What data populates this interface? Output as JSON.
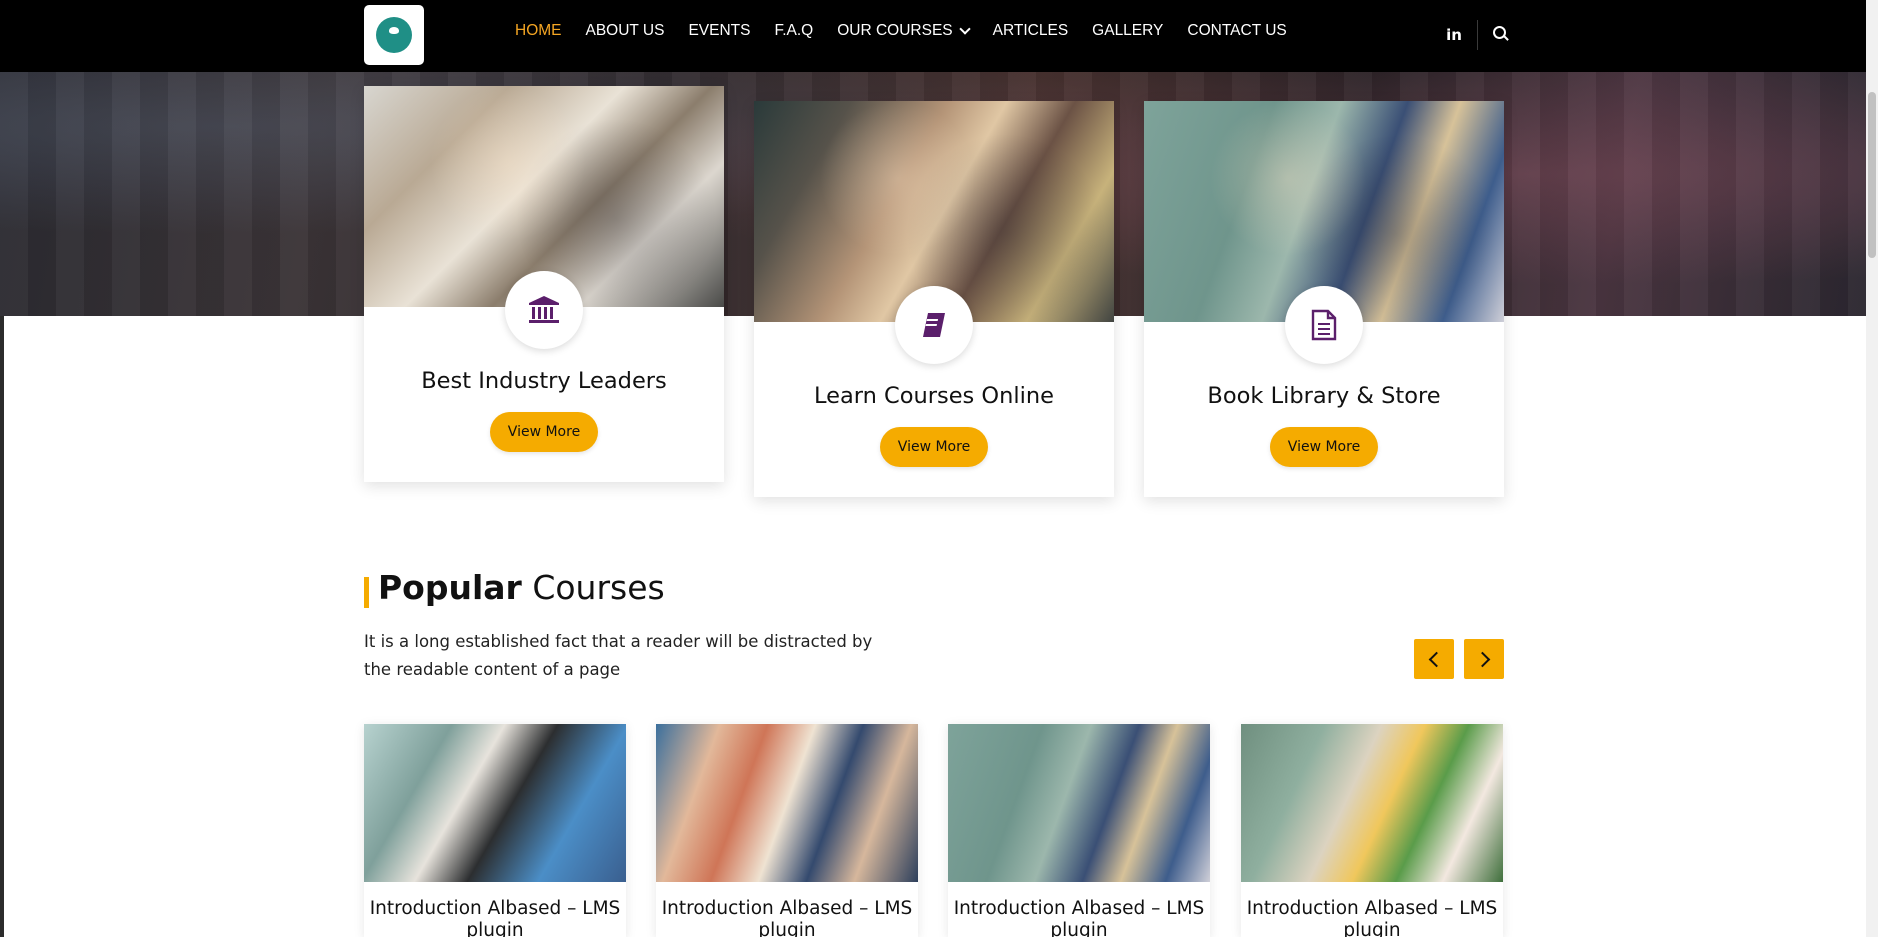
{
  "nav": {
    "items": [
      {
        "label": "HOME",
        "active": true
      },
      {
        "label": "ABOUT US"
      },
      {
        "label": "EVENTS"
      },
      {
        "label": "F.A.Q"
      },
      {
        "label": "OUR COURSES",
        "dropdown": true
      },
      {
        "label": "ARTICLES"
      },
      {
        "label": "GALLERY"
      },
      {
        "label": "CONTACT US"
      }
    ],
    "social_icon": "linkedin-icon",
    "social_label": "in",
    "search_icon": "search-icon",
    "accent_color": "#f5a623"
  },
  "features": [
    {
      "title": "Best Industry Leaders",
      "icon": "institution-icon",
      "button": "View More"
    },
    {
      "title": "Learn Courses Online",
      "icon": "book-icon",
      "button": "View More"
    },
    {
      "title": "Book Library & Store",
      "icon": "document-icon",
      "button": "View More"
    }
  ],
  "popular": {
    "title_bold": "Popular",
    "title_light": "Courses",
    "description": "It is a long established fact that a reader will be distracted by the readable content of a page",
    "prev_icon": "chevron-left-icon",
    "next_icon": "chevron-right-icon",
    "courses": [
      {
        "title": "Introduction Albased – LMS plugin"
      },
      {
        "title": "Introduction Albased – LMS plugin"
      },
      {
        "title": "Introduction Albased – LMS plugin"
      },
      {
        "title": "Introduction Albased – LMS plugin"
      }
    ]
  },
  "colors": {
    "button": "#f5ab00",
    "icon": "#5b1f6b",
    "nav_bg": "#000000"
  }
}
